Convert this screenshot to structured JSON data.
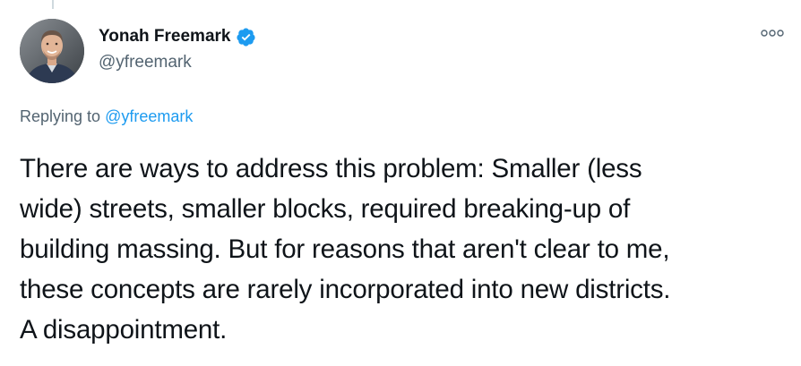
{
  "author": {
    "display_name": "Yonah Freemark",
    "handle": "@yfreemark",
    "verified": true,
    "avatar_icon": "profile-photo"
  },
  "reply_context": {
    "prefix": "Replying to",
    "mention": "@yfreemark"
  },
  "tweet": {
    "lines": [
      "There are ways to address this problem: Smaller (less",
      "wide) streets, smaller blocks, required breaking-up of",
      "building massing. But for reasons that aren't clear to me,",
      "these concepts are rarely incorporated into new districts.",
      "A disappointment."
    ]
  },
  "icons": {
    "verified": "verified-badge-icon",
    "more": "more-options-icon"
  },
  "colors": {
    "text": "#0f1419",
    "secondary": "#536471",
    "link": "#1d9bf0",
    "verified": "#1d9bf0"
  }
}
